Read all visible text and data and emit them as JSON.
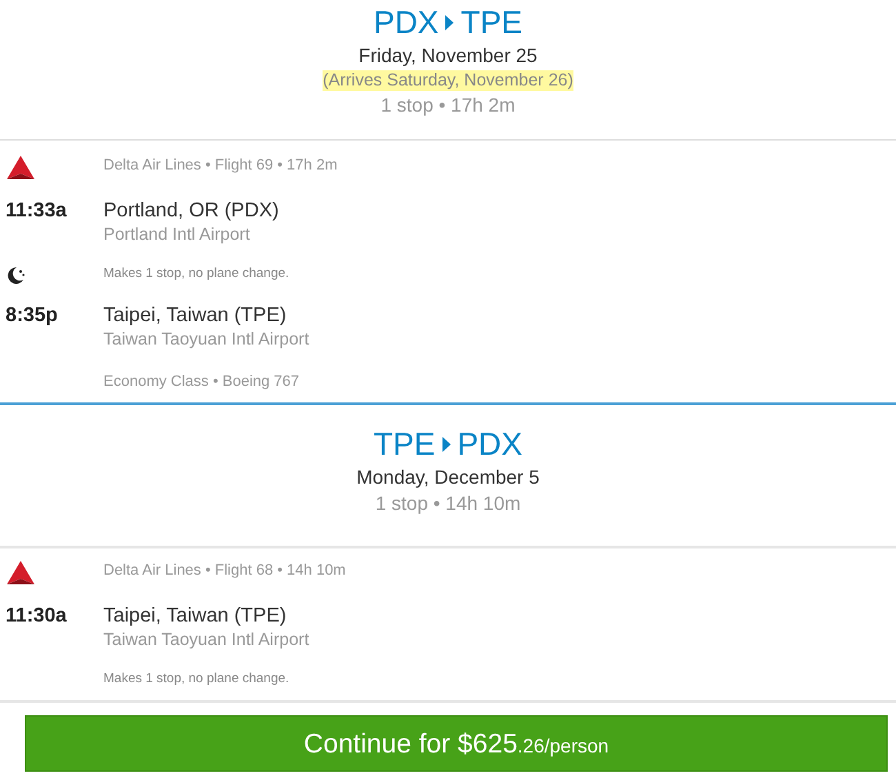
{
  "legs": [
    {
      "origin": "PDX",
      "destination": "TPE",
      "date": "Friday, November 25",
      "arrives_note": "(Arrives Saturday, November 26)",
      "summary": "1 stop • 17h 2m",
      "rows": [
        {
          "kind": "carrier",
          "text": "Delta Air Lines • Flight 69 • 17h 2m"
        },
        {
          "kind": "stop",
          "time": "11:33a",
          "city": "Portland, OR (PDX)",
          "airport": "Portland Intl Airport"
        },
        {
          "kind": "note",
          "overnight": true,
          "text": "Makes 1 stop, no plane change."
        },
        {
          "kind": "stop",
          "time": "8:35p",
          "city": "Taipei, Taiwan (TPE)",
          "airport": "Taiwan Taoyuan Intl Airport"
        },
        {
          "kind": "details",
          "text": "Economy Class • Boeing 767"
        }
      ]
    },
    {
      "origin": "TPE",
      "destination": "PDX",
      "date": "Monday, December 5",
      "summary": "1 stop • 14h 10m",
      "rows": [
        {
          "kind": "carrier",
          "text": "Delta Air Lines • Flight 68 • 14h 10m"
        },
        {
          "kind": "stop",
          "time": "11:30a",
          "city": "Taipei, Taiwan (TPE)",
          "airport": "Taiwan Taoyuan Intl Airport"
        },
        {
          "kind": "note",
          "overnight": false,
          "text": "Makes 1 stop, no plane change."
        }
      ]
    }
  ],
  "continue_button": {
    "label": "Continue for $625",
    "suffix": ".26/person"
  }
}
